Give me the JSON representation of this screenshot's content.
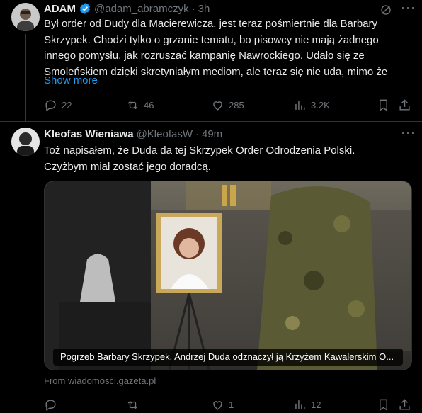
{
  "colors": {
    "background": "#000000",
    "text": "#e7e9ea",
    "muted": "#71767b",
    "link": "#1d9bf0",
    "verified": "#1d9bf0"
  },
  "tweet1": {
    "display_name": "ADAM",
    "handle": "@adam_abramczyk",
    "separator": "·",
    "time": "3h",
    "text_line1": "Był order od Dudy dla Macierewicza, jest teraz pośmiertnie dla Barbary",
    "text_line2": "Skrzypek. Chodzi tylko o grzanie tematu, bo pisowcy nie mają żadnego",
    "text_line3": "innego pomysłu, jak rozruszać kampanię Nawrockiego. Udało się ze",
    "text_line4": "Smoleńskiem dzięki skretyniałym mediom, ale teraz się nie uda, mimo że",
    "show_more": "Show more",
    "replies": "22",
    "reposts": "46",
    "likes": "285",
    "views": "3.2K"
  },
  "tweet2": {
    "display_name": "Kleofas Wieniawa",
    "handle": "@KleofasW",
    "separator": "·",
    "time": "49m",
    "text_line1": "Toż napisałem, że Duda da tej Skrzypek Order Odrodzenia Polski.",
    "text_line2": "Czyżbym miał zostać jego doradcą.",
    "media_caption": "Pogrzeb Barbary Skrzypek. Andrzej Duda odznaczył ją Krzyżem Kawalerskim O...",
    "source": "From wiadomosci.gazeta.pl",
    "replies": "",
    "reposts": "",
    "likes": "1",
    "views": "12"
  }
}
